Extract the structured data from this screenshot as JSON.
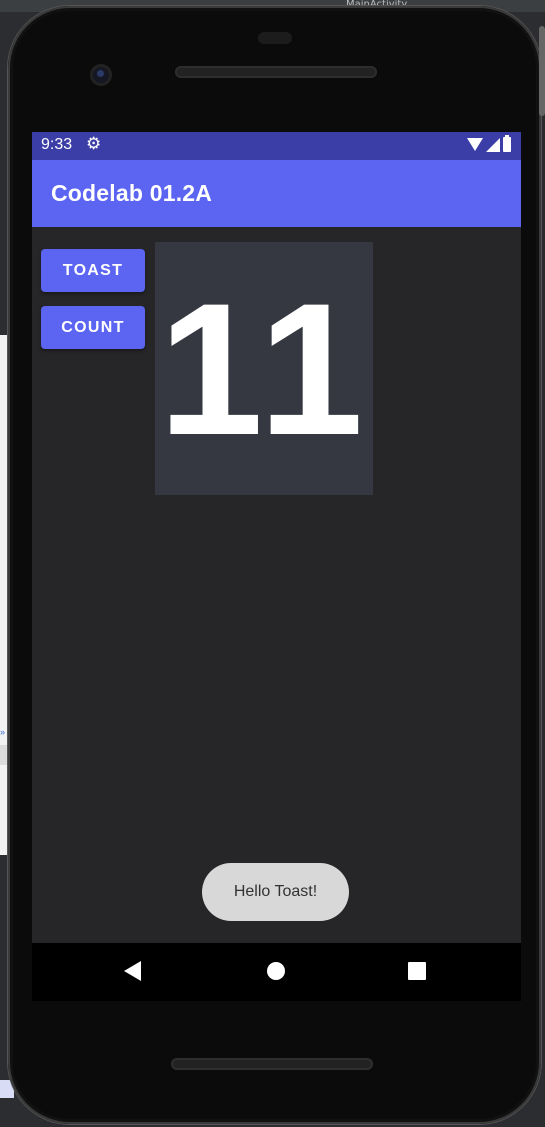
{
  "desktop": {
    "tab_text": "MainActivity"
  },
  "status_bar": {
    "time": "9:33",
    "settings_icon": "gear-icon",
    "wifi_icon": "wifi-icon",
    "signal_icon": "signal-icon",
    "battery_icon": "battery-icon"
  },
  "app_bar": {
    "title": "Codelab 01.2A"
  },
  "buttons": {
    "toast_label": "TOAST",
    "count_label": "COUNT"
  },
  "counter": {
    "value": "11"
  },
  "toast": {
    "message": "Hello Toast!"
  },
  "nav_bar": {
    "back_icon": "back-triangle-icon",
    "home_icon": "home-circle-icon",
    "recents_icon": "recents-square-icon"
  },
  "colors": {
    "primary": "#5b65f2",
    "status_bar": "#3b3ea6",
    "background": "#262629",
    "counter_bg": "#353741",
    "toast_bg": "#d8d8d8"
  }
}
